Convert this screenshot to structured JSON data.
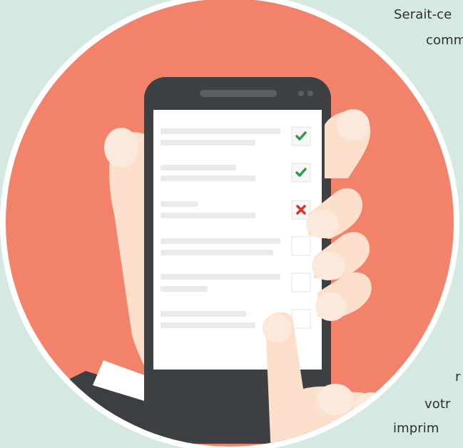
{
  "text_fragments": [
    {
      "id": "t1",
      "text": "Serait-ce"
    },
    {
      "id": "t2",
      "text": "comm"
    },
    {
      "id": "t3",
      "text": "r"
    },
    {
      "id": "t4",
      "text": "votr"
    },
    {
      "id": "t5",
      "text": "imprim"
    }
  ],
  "colors": {
    "background": "#d4e9df",
    "circle": "#f2826a",
    "ring": "#ffffff",
    "phone_body": "#3d4144",
    "screen": "#ffffff",
    "skin": "#fde0cb",
    "check": "#2d9d48",
    "cross": "#d8322e"
  },
  "checklist": [
    {
      "status": "checked",
      "icon": "check-icon"
    },
    {
      "status": "checked",
      "icon": "check-icon"
    },
    {
      "status": "rejected",
      "icon": "cross-icon"
    },
    {
      "status": "empty",
      "icon": "empty-box-icon"
    },
    {
      "status": "empty",
      "icon": "empty-box-icon"
    },
    {
      "status": "empty",
      "icon": "empty-box-icon"
    }
  ]
}
